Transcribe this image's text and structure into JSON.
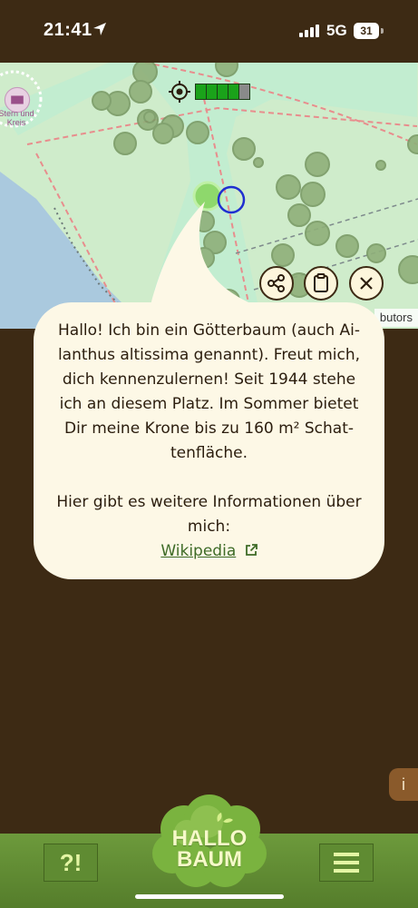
{
  "status_bar": {
    "time": "21:41",
    "network": "5G",
    "battery": "31"
  },
  "map": {
    "zone_label_line1": "Stern und",
    "zone_label_line2": "Kreis",
    "attribution": "butors",
    "gps_accuracy_segments_filled": 4,
    "gps_accuracy_segments_total": 5,
    "colors": {
      "park": "#cfeccb",
      "path": "#b8e6c3",
      "water": "#aac9de",
      "tree": "#8fb07a",
      "user_location": "#1f2fd0",
      "selected_tree": "#8ed86c"
    }
  },
  "actions": {
    "share_icon": "share-icon",
    "copy_icon": "clipboard-icon",
    "close_icon": "close-icon"
  },
  "bubble": {
    "line1": "Hallo! Ich bin ein Götterbaum (auch Ai-",
    "line2": "lanthus altissima genannt). Freut mich,",
    "line3": "dich kennenzulernen! Seit 1944 stehe",
    "line4": "ich an diesem Platz. Im Sommer bietet",
    "line5": "Dir meine Krone bis zu 160 m² Schat-",
    "line6": "tenfläche.",
    "info_line1": "Hier gibt es weitere Informationen über",
    "info_line2": "mich:",
    "link_label": "Wikipedia"
  },
  "info_tab": "i",
  "bottom_bar": {
    "help_label": "?!",
    "logo_line1": "HALLO",
    "logo_line2": "BAUM",
    "menu_icon": "menu-icon"
  }
}
